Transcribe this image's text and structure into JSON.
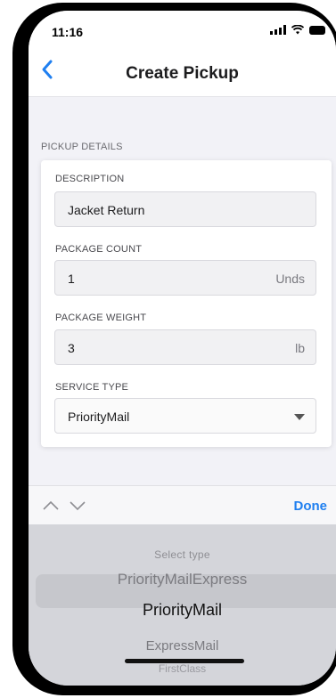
{
  "status_bar": {
    "time": "11:16"
  },
  "nav": {
    "title": "Create Pickup",
    "back_icon": "chevron-left-icon"
  },
  "section": {
    "label": "PICKUP DETAILS"
  },
  "form": {
    "description": {
      "label": "DESCRIPTION",
      "value": "Jacket Return"
    },
    "package_count": {
      "label": "PACKAGE COUNT",
      "value": "1",
      "unit": "Unds"
    },
    "package_weight": {
      "label": "PACKAGE WEIGHT",
      "value": "3",
      "unit": "lb"
    },
    "service_type": {
      "label": "SERVICE TYPE",
      "value": "PriorityMail"
    }
  },
  "toolbar": {
    "done_label": "Done"
  },
  "picker": {
    "items": [
      "Select type",
      "PriorityMailExpress",
      "PriorityMail",
      "ExpressMail",
      "FirstClass"
    ],
    "selected": "PriorityMail"
  },
  "colors": {
    "accent": "#1f7ff0",
    "picker_bg": "#d4d5da"
  }
}
